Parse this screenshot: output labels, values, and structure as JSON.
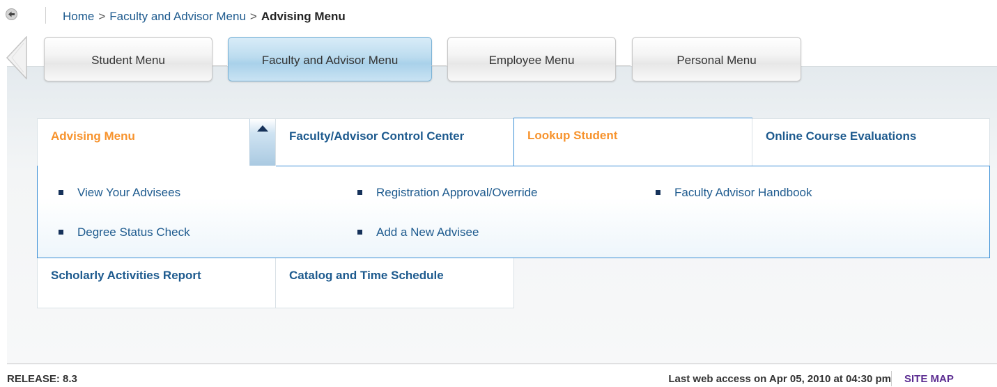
{
  "breadcrumb": {
    "home": "Home",
    "separator": ">",
    "parent": "Faculty and Advisor Menu",
    "current": "Advising Menu"
  },
  "tabs": [
    {
      "label": "Student Menu",
      "active": false
    },
    {
      "label": "Faculty and Advisor Menu",
      "active": true
    },
    {
      "label": "Employee Menu",
      "active": false
    },
    {
      "label": "Personal Menu",
      "active": false
    }
  ],
  "menu_cards": {
    "advising": "Advising Menu",
    "control_center": "Faculty/Advisor Control Center",
    "lookup_student": "Lookup Student",
    "course_evaluations": "Online Course Evaluations",
    "scholarly": "Scholarly Activities Report",
    "catalog": "Catalog and Time Schedule"
  },
  "advising_links": {
    "view_advisees": "View Your Advisees",
    "registration_approval": "Registration Approval/Override",
    "handbook": "Faculty Advisor Handbook",
    "degree_status": "Degree Status Check",
    "add_advisee": "Add a New Advisee"
  },
  "footer": {
    "release": "RELEASE: 8.3",
    "last_access": "Last web access on Apr 05, 2010 at 04:30 pm",
    "site_map": "SITE MAP"
  },
  "colors": {
    "link_blue": "#1d5a8e",
    "orange_active": "#f7932d",
    "highlight_border": "#3b8fd6",
    "site_map_purple": "#5b2c91"
  },
  "icons": [
    "back-arrow-icon",
    "scroll-left-icon",
    "collapse-up-icon",
    "bullet-square-icon"
  ]
}
